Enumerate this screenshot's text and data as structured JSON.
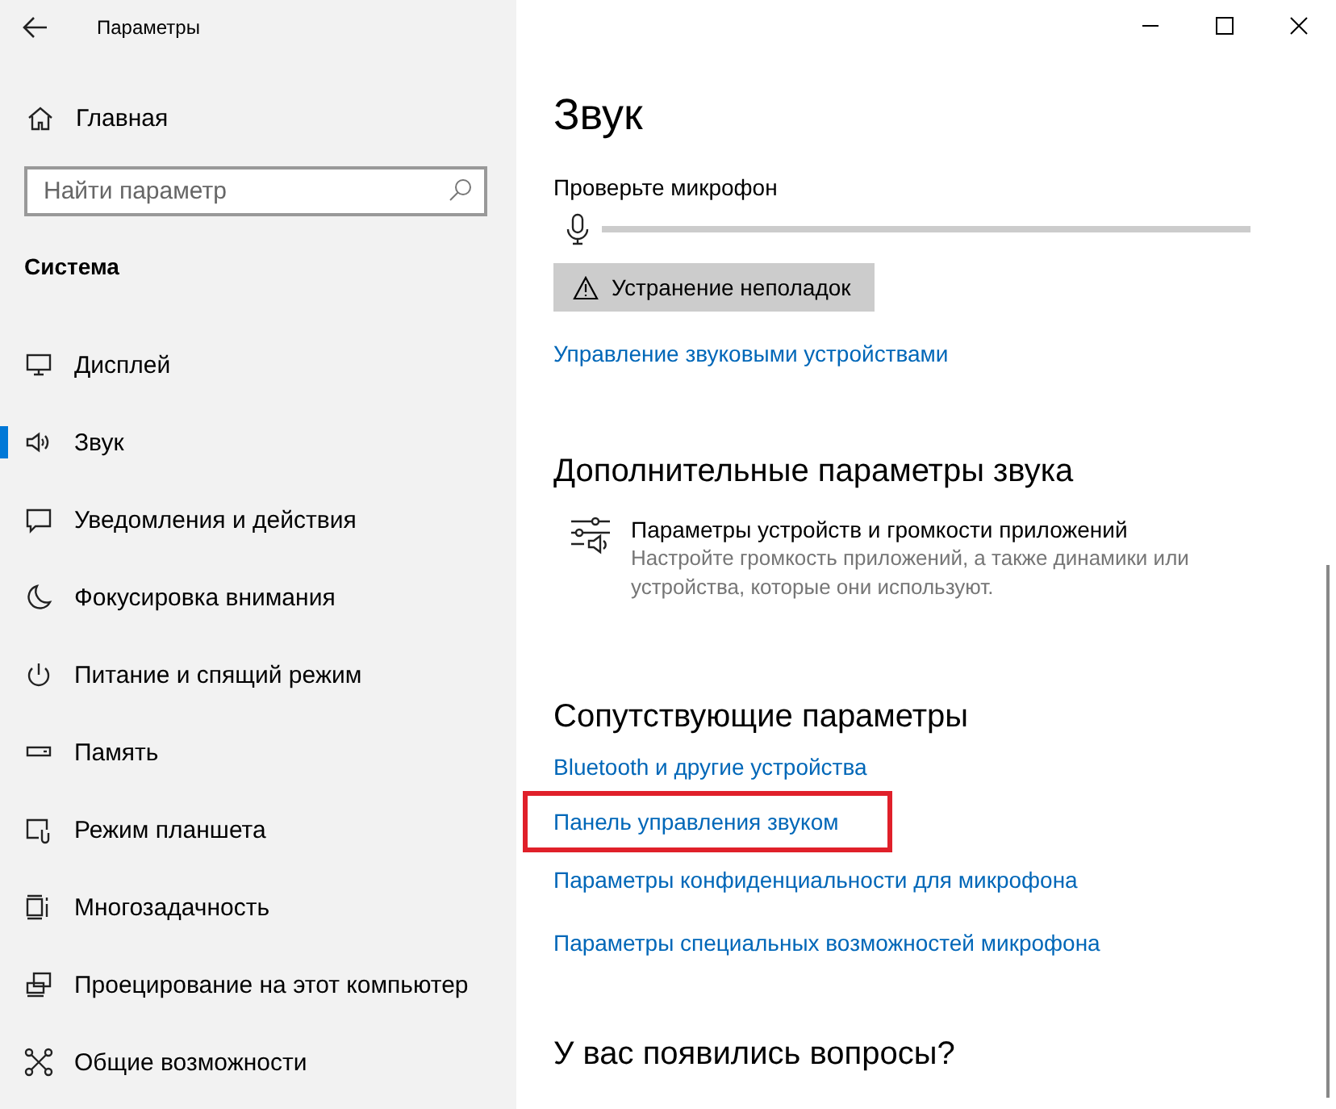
{
  "window": {
    "title": "Параметры"
  },
  "sidebar": {
    "home": "Главная",
    "search": {
      "placeholder": "Найти параметр"
    },
    "section": "Система",
    "items": [
      {
        "label": "Дисплей",
        "selected": false
      },
      {
        "label": "Звук",
        "selected": true
      },
      {
        "label": "Уведомления и действия",
        "selected": false
      },
      {
        "label": "Фокусировка внимания",
        "selected": false
      },
      {
        "label": "Питание и спящий режим",
        "selected": false
      },
      {
        "label": "Память",
        "selected": false
      },
      {
        "label": "Режим планшета",
        "selected": false
      },
      {
        "label": "Многозадачность",
        "selected": false
      },
      {
        "label": "Проецирование на этот компьютер",
        "selected": false
      },
      {
        "label": "Общие возможности",
        "selected": false
      }
    ]
  },
  "content": {
    "title": "Звук",
    "mic_test": {
      "label": "Проверьте микрофон",
      "level": 0
    },
    "troubleshoot_button": "Устранение неполадок",
    "manage_link": "Управление звуковыми устройствами",
    "advanced": {
      "heading": "Дополнительные параметры звука",
      "item": {
        "title": "Параметры устройств и громкости приложений",
        "description": "Настройте громкость приложений, а также динамики или устройства, которые они используют."
      }
    },
    "related": {
      "heading": "Сопутствующие параметры",
      "links": [
        {
          "label": "Bluetooth и другие устройства",
          "highlighted": false
        },
        {
          "label": "Панель управления звуком",
          "highlighted": true
        },
        {
          "label": "Параметры конфиденциальности для микрофона",
          "highlighted": false
        },
        {
          "label": "Параметры специальных возможностей микрофона",
          "highlighted": false
        }
      ]
    },
    "questions_heading": "У вас появились вопросы?"
  }
}
